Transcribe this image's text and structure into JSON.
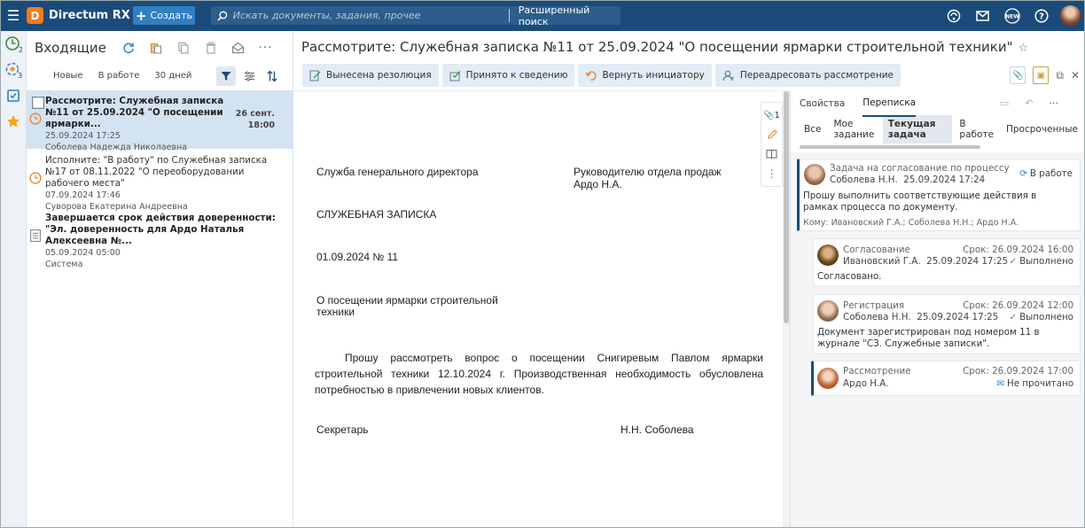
{
  "app": {
    "logo_letter": "D",
    "name": "Directum RX",
    "create_label": "Создать",
    "search_placeholder": "Искать документы, задания, прочее",
    "advanced_search": "Расширенный поиск",
    "new_badge": "NEW"
  },
  "rail": {
    "inbox_count": "2",
    "tasks_count": "3"
  },
  "list": {
    "title": "Входящие",
    "filters": [
      "Новые",
      "В работе",
      "30 дней"
    ],
    "items": [
      {
        "title": "Рассмотрите: Служебная записка №11 от 25.09.2024 \"О посещении ярмарки...",
        "date": "25.09.2024 17:25",
        "author": "Соболева Надежда Николаевна",
        "due_day": "26 сент.",
        "due_time": "18:00"
      },
      {
        "title": "Исполните: \"В работу\" по Служебная записка №17 от 08.11.2022 \"О переоборудовании рабочего места\"",
        "date": "07.09.2024 17:46",
        "author": "Суворова Екатерина Андреевна"
      },
      {
        "title": "Завершается срок действия доверенности: \"Эл. доверенность для Ардо Наталья Алексеевна №...",
        "date": "05.09.2024 05:00",
        "author": "Система"
      }
    ]
  },
  "document": {
    "title": "Рассмотрите: Служебная записка №11 от 25.09.2024 \"О посещении ярмарки строительной техники\"",
    "actions": [
      "Вынесена резолюция",
      "Принято к сведению",
      "Вернуть инициатору",
      "Переадресовать рассмотрение"
    ],
    "attach_count": "1",
    "body": {
      "department": "Служба генерального директора",
      "addressee_line1": "Руководителю отдела продаж",
      "addressee_line2": "Ардо Н.А.",
      "doc_type": "СЛУЖЕБНАЯ ЗАПИСКА",
      "number_line": "01.09.2024 № 11",
      "subject_line1": "О посещении ярмарки строительной",
      "subject_line2": "техники",
      "paragraph": "Прошу рассмотреть вопрос о посещении Снигиревым Павлом ярмарки строительной техники 12.10.2024 г. Производственная необходимость обусловлена потребностью в привлечении новых клиентов.",
      "signer_role": "Секретарь",
      "signer_name": "Н.Н. Соболева"
    }
  },
  "right": {
    "tabs": [
      "Свойства",
      "Переписка"
    ],
    "subtabs": [
      "Все",
      "Мое задание",
      "Текущая задача",
      "В работе",
      "Просроченные"
    ],
    "main_card": {
      "title": "Задача на согласование по процессу",
      "author": "Соболева Н.Н.",
      "date": "25.09.2024 17:24",
      "status": "В работе",
      "text": "Прошу выполнить соответствующие действия в рамках процесса по документу.",
      "to": "Кому: Ивановский Г.А.; Соболева Н.Н.; Ардо Н.А."
    },
    "sub_cards": [
      {
        "stage": "Согласование",
        "due": "Срок: 26.09.2024 16:00",
        "author": "Ивановский Г.А.",
        "date": "25.09.2024 17:25",
        "status": "Выполнено",
        "text": "Согласовано."
      },
      {
        "stage": "Регистрация",
        "due": "Срок: 26.09.2024 12:00",
        "author": "Соболева Н.Н.",
        "date": "25.09.2024 17:25",
        "status": "Выполнено",
        "text": "Документ зарегистрирован под номером 11 в журнале \"СЗ. Служебные записки\"."
      },
      {
        "stage": "Рассмотрение",
        "due": "Срок: 26.09.2024 17:00",
        "author": "Ардо Н.А.",
        "status": "Не прочитано"
      }
    ]
  }
}
